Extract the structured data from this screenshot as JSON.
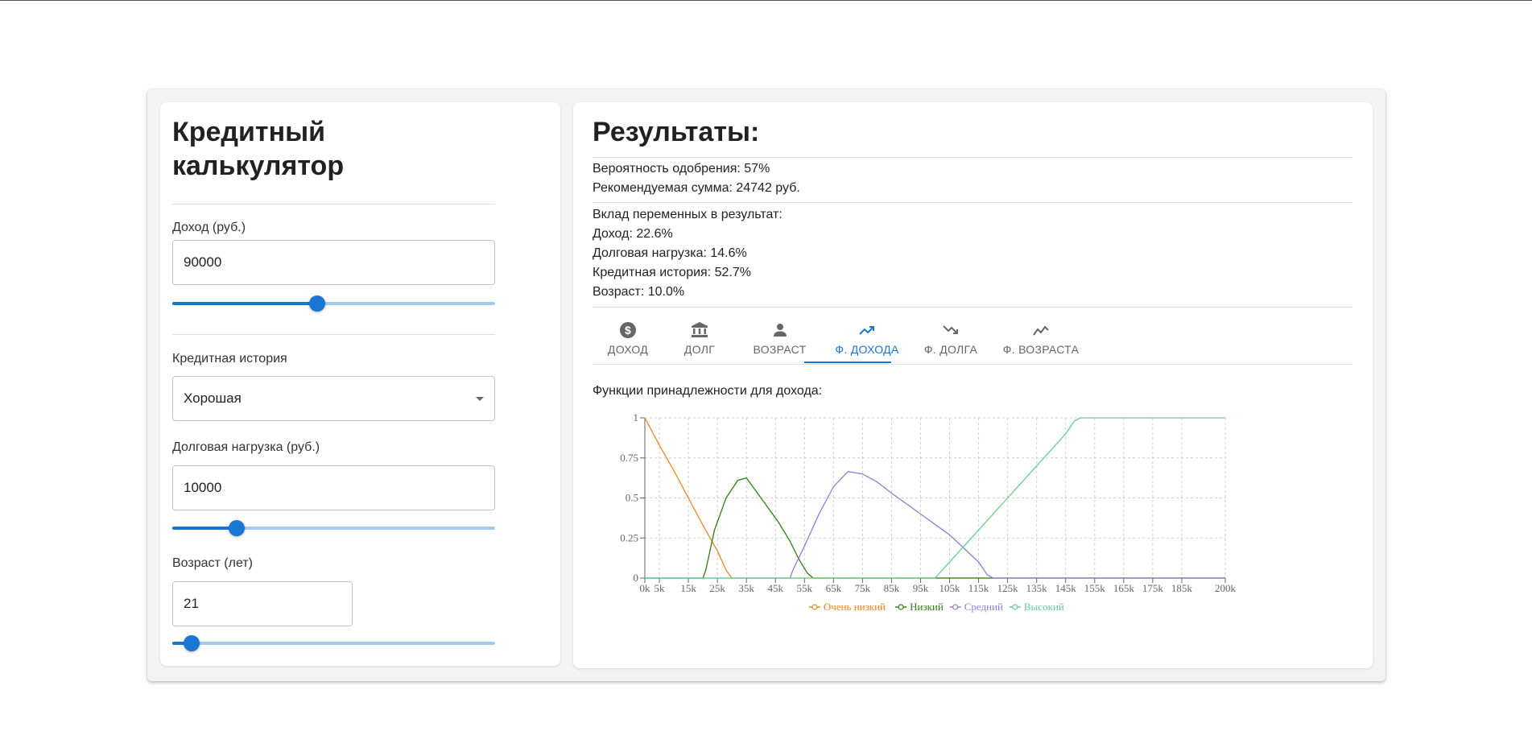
{
  "calculator": {
    "title": "Кредитный калькулятор",
    "income": {
      "label": "Доход (руб.)",
      "value": "90000",
      "slider_fraction": 0.45
    },
    "credit_history": {
      "label": "Кредитная история",
      "value": "Хорошая"
    },
    "debt": {
      "label": "Долговая нагрузка (руб.)",
      "value": "10000",
      "slider_fraction": 0.2
    },
    "age": {
      "label": "Возраст (лет)",
      "value": "21",
      "slider_fraction": 0.06
    }
  },
  "results": {
    "title": "Результаты:",
    "approval": "Вероятность одобрения: 57%",
    "recommended": "Рекомендуемая сумма: 24742 руб.",
    "contrib_header": "Вклад переменных в результат:",
    "contrib_income": "Доход: 22.6%",
    "contrib_debt": "Долговая нагрузка: 14.6%",
    "contrib_history": "Кредитная история: 52.7%",
    "contrib_age": "Возраст: 10.0%"
  },
  "tabs": [
    {
      "label": "ДОХОД",
      "icon": "dollar-circle-icon"
    },
    {
      "label": "ДОЛГ",
      "icon": "bank-icon"
    },
    {
      "label": "ВОЗРАСТ",
      "icon": "person-icon"
    },
    {
      "label": "Ф. ДОХОДА",
      "icon": "trending-up-icon",
      "active": true
    },
    {
      "label": "Ф. ДОЛГА",
      "icon": "trending-down-icon"
    },
    {
      "label": "Ф. ВОЗРАСТА",
      "icon": "show-chart-icon"
    }
  ],
  "colors": {
    "accent": "#1976d2"
  },
  "chart_data": {
    "type": "line",
    "title": "Функции принадлежности для дохода:",
    "x_ticks": [
      "0k",
      "5k",
      "15k",
      "25k",
      "35k",
      "45k",
      "55k",
      "65k",
      "75k",
      "85k",
      "95k",
      "105k",
      "115k",
      "125k",
      "135k",
      "145k",
      "155k",
      "165k",
      "175k",
      "185k",
      "200k"
    ],
    "x_tick_values": [
      0,
      5,
      15,
      25,
      35,
      45,
      55,
      65,
      75,
      85,
      95,
      105,
      115,
      125,
      135,
      145,
      155,
      165,
      175,
      185,
      200
    ],
    "y_ticks": [
      "0",
      "0.25",
      "0.5",
      "0.75",
      "1"
    ],
    "xlim": [
      0,
      200
    ],
    "ylim": [
      0,
      1
    ],
    "grid": true,
    "legend_position": "bottom-center",
    "series": [
      {
        "name": "Очень низкий",
        "color": "#f58220",
        "points": [
          [
            0,
            1
          ],
          [
            5,
            0.83
          ],
          [
            10,
            0.67
          ],
          [
            15,
            0.5
          ],
          [
            20,
            0.33
          ],
          [
            25,
            0.17
          ],
          [
            28,
            0.05
          ],
          [
            30,
            0
          ],
          [
            200,
            0
          ]
        ]
      },
      {
        "name": "Низкий",
        "color": "#2e7d15",
        "points": [
          [
            0,
            0
          ],
          [
            20,
            0
          ],
          [
            21,
            0.05
          ],
          [
            24,
            0.3
          ],
          [
            28,
            0.5
          ],
          [
            32,
            0.61
          ],
          [
            35,
            0.625
          ],
          [
            38,
            0.55
          ],
          [
            42,
            0.45
          ],
          [
            46,
            0.35
          ],
          [
            50,
            0.23
          ],
          [
            53,
            0.12
          ],
          [
            56,
            0.03
          ],
          [
            58,
            0
          ],
          [
            200,
            0
          ]
        ]
      },
      {
        "name": "Средний",
        "color": "#8c7fd9",
        "points": [
          [
            0,
            0
          ],
          [
            50,
            0
          ],
          [
            51,
            0.05
          ],
          [
            55,
            0.2
          ],
          [
            60,
            0.4
          ],
          [
            65,
            0.57
          ],
          [
            70,
            0.665
          ],
          [
            75,
            0.65
          ],
          [
            80,
            0.6
          ],
          [
            85,
            0.53
          ],
          [
            95,
            0.4
          ],
          [
            105,
            0.27
          ],
          [
            115,
            0.1
          ],
          [
            118,
            0.02
          ],
          [
            120,
            0
          ],
          [
            200,
            0
          ]
        ]
      },
      {
        "name": "Высокий",
        "color": "#66cc90",
        "points": [
          [
            0,
            0
          ],
          [
            100,
            0
          ],
          [
            101,
            0.02
          ],
          [
            105,
            0.1
          ],
          [
            115,
            0.3
          ],
          [
            125,
            0.5
          ],
          [
            135,
            0.7
          ],
          [
            145,
            0.9
          ],
          [
            148,
            0.98
          ],
          [
            150,
            1
          ],
          [
            200,
            1
          ]
        ]
      }
    ]
  }
}
